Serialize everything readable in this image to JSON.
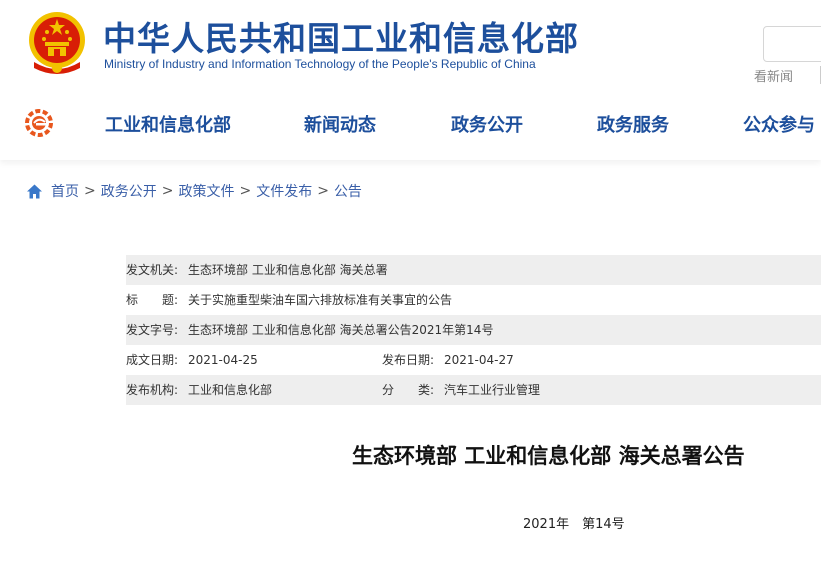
{
  "header": {
    "title": "中华人民共和国工业和信息化部",
    "subtitle": "Ministry of Industry and Information Technology of the People's Republic of China",
    "news_link": "看新闻",
    "colors": {
      "brand_blue": "#1d4f9c",
      "emblem_red": "#d81e06",
      "emblem_gold": "#f2c200"
    }
  },
  "nav": {
    "items": [
      {
        "label": "工业和信息化部"
      },
      {
        "label": "新闻动态"
      },
      {
        "label": "政务公开"
      },
      {
        "label": "政务服务"
      },
      {
        "label": "公众参与"
      }
    ]
  },
  "breadcrumb": {
    "icon": "home-icon",
    "items": [
      "首页",
      "政务公开",
      "政策文件",
      "文件发布",
      "公告"
    ],
    "separator": ">"
  },
  "info": {
    "issuer_label": "发文机关:",
    "issuer_value": "生态环境部 工业和信息化部 海关总署",
    "title_label": "标　　题:",
    "title_value": "关于实施重型柴油车国六排放标准有关事宜的公告",
    "docno_label": "发文字号:",
    "docno_value": "生态环境部 工业和信息化部 海关总署公告2021年第14号",
    "written_label": "成文日期:",
    "written_value": "2021-04-25",
    "published_label": "发布日期:",
    "published_value": "2021-04-27",
    "org_label": "发布机构:",
    "org_value": "工业和信息化部",
    "category_label": "分　　类:",
    "category_value": "汽车工业行业管理"
  },
  "document": {
    "title": "生态环境部 工业和信息化部 海关总署公告",
    "number": "2021年　第14号"
  }
}
